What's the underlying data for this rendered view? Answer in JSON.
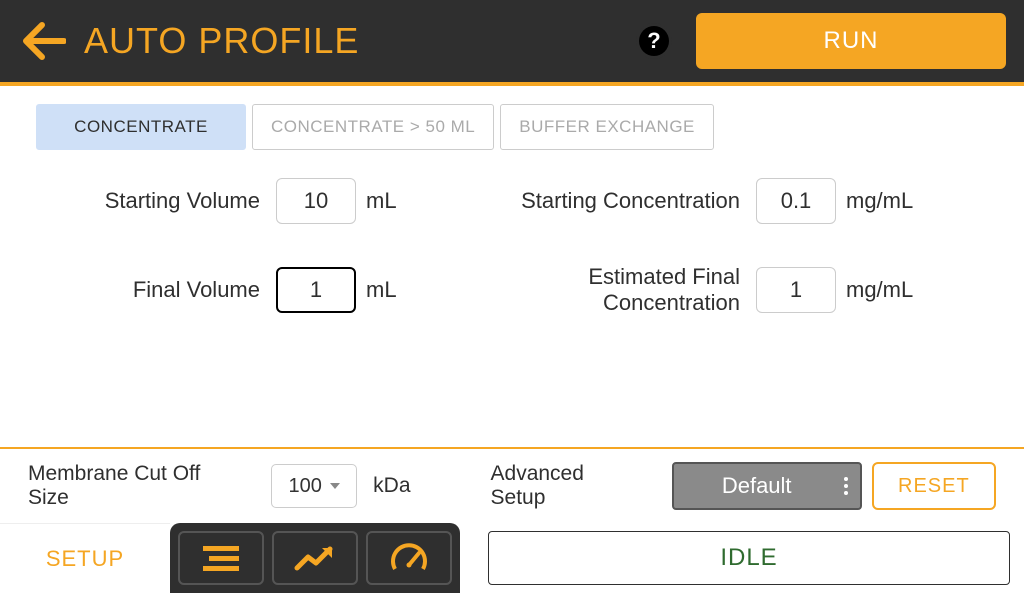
{
  "header": {
    "title": "AUTO PROFILE",
    "run_label": "RUN"
  },
  "tabs": {
    "concentrate": "CONCENTRATE",
    "concentrate_50": "CONCENTRATE > 50 ML",
    "buffer_exchange": "BUFFER EXCHANGE"
  },
  "params": {
    "starting_volume_label": "Starting Volume",
    "starting_volume_value": "10",
    "starting_volume_unit": "mL",
    "final_volume_label": "Final Volume",
    "final_volume_value": "1",
    "final_volume_unit": "mL",
    "starting_conc_label": "Starting Concentration",
    "starting_conc_value": "0.1",
    "starting_conc_unit": "mg/mL",
    "final_conc_label": "Estimated Final Concentration",
    "final_conc_value": "1",
    "final_conc_unit": "mg/mL"
  },
  "options": {
    "cutoff_label": "Membrane Cut Off Size",
    "cutoff_value": "100",
    "cutoff_unit": "kDa",
    "advanced_label": "Advanced Setup",
    "advanced_value": "Default",
    "reset_label": "RESET"
  },
  "bottom": {
    "setup_label": "SETUP",
    "status": "IDLE"
  },
  "icons": {
    "back": "back-arrow-icon",
    "help": "help-icon",
    "list": "list-icon",
    "trend": "trend-up-icon",
    "gauge": "gauge-icon"
  }
}
